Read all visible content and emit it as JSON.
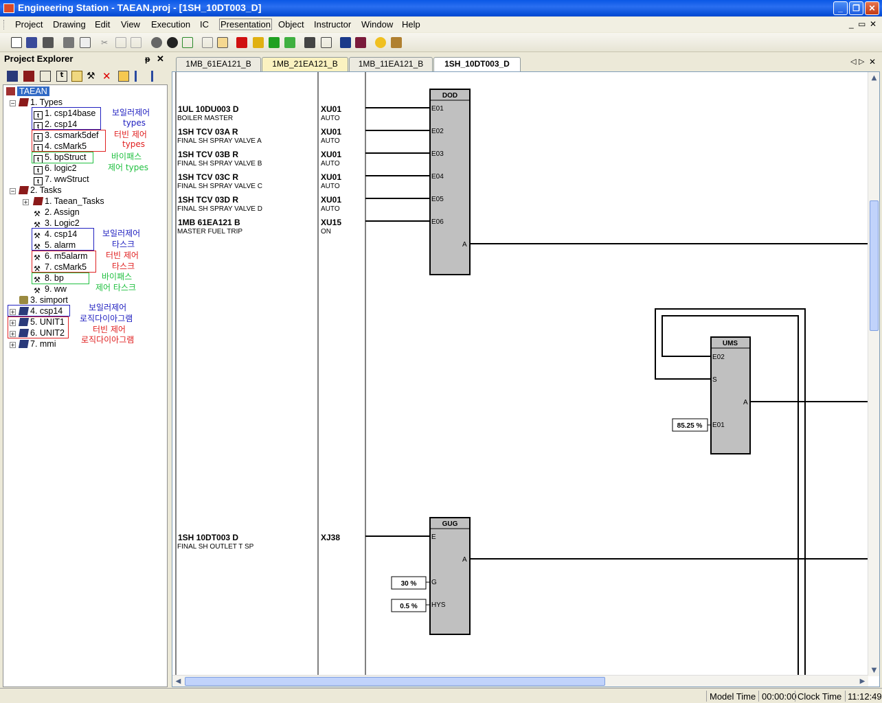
{
  "window": {
    "title": "Engineering Station - TAEAN.proj - [1SH_10DT003_D]",
    "min_icon": "minimize-icon",
    "max_icon": "restore-icon",
    "close_icon": "close-icon"
  },
  "menu": [
    "Project",
    "Drawing",
    "Edit",
    "View",
    "Execution",
    "IC",
    "Presentation",
    "Object",
    "Instructor",
    "Window",
    "Help"
  ],
  "explorer": {
    "title": "Project Explorer",
    "root": "TAEAN",
    "nodes": [
      "1. Types",
      "1. csp14base",
      "2. csp14",
      "3. csmark5def",
      "4. csMark5",
      "5. bpStruct",
      "6. logic2",
      "7. wwStruct",
      "2. Tasks",
      "1. Taean_Tasks",
      "2. Assign",
      "3. Logic2",
      "4. csp14",
      "5. alarm",
      "6. m5alarm",
      "7. csMark5",
      "8. bp",
      "9. ww",
      "3. simport",
      "4. csp14",
      "5. UNIT1",
      "6. UNIT2",
      "7. mmi"
    ],
    "annotations": {
      "boiler_types_1": "보일러제어",
      "boiler_types_2": "types",
      "turbine_types_1": "터빈 제어",
      "turbine_types_2": "types",
      "bypass_types_1": "바이패스",
      "bypass_types_2": "제어 types",
      "boiler_task_1": "보일러제어",
      "boiler_task_2": "타스크",
      "turbine_task_1": "터빈 제어",
      "turbine_task_2": "타스크",
      "bypass_task_1": "바이패스",
      "bypass_task_2": "제어 타스크",
      "boiler_logic_1": "보일러제어",
      "boiler_logic_2": "로직다이아그램",
      "turbine_logic_1": "터빈 제어",
      "turbine_logic_2": "로직다이아그램"
    },
    "colors": {
      "blue": "#2020c0",
      "red": "#e02020",
      "green": "#20c040"
    }
  },
  "tabs": [
    {
      "label": "1MB_61EA121_B",
      "active": false
    },
    {
      "label": "1MB_21EA121_B",
      "active": false
    },
    {
      "label": "1MB_11EA121_B",
      "active": false
    },
    {
      "label": "1SH_10DT003_D",
      "active": true
    }
  ],
  "signals": [
    {
      "tag": "1UL 10DU003 D",
      "desc": "BOILER MASTER",
      "code": "XU01",
      "state": "AUTO"
    },
    {
      "tag": "1SH TCV 03A R",
      "desc": "FINAL SH SPRAY VALVE A",
      "code": "XU01",
      "state": "AUTO"
    },
    {
      "tag": "1SH TCV 03B R",
      "desc": "FINAL SH SPRAY VALVE B",
      "code": "XU01",
      "state": "AUTO"
    },
    {
      "tag": "1SH TCV 03C R",
      "desc": "FINAL SH SPRAY VALVE C",
      "code": "XU01",
      "state": "AUTO"
    },
    {
      "tag": "1SH TCV 03D R",
      "desc": "FINAL SH SPRAY VALVE D",
      "code": "XU01",
      "state": "AUTO"
    },
    {
      "tag": "1MB 61EA121 B",
      "desc": "MASTER FUEL TRIP",
      "code": "XU15",
      "state": "ON"
    },
    {
      "tag": "1SH 10DT003 D",
      "desc": "FINAL SH OUTLET T SP",
      "code": "XJ38",
      "state": ""
    }
  ],
  "blocks": {
    "dod": {
      "name": "DOD",
      "inputs": [
        "E01",
        "E02",
        "E03",
        "E04",
        "E05",
        "E06"
      ],
      "output": "A"
    },
    "ums": {
      "name": "UMS",
      "inputs": [
        "E02",
        "S",
        "E01"
      ],
      "output": "A",
      "e01_value": "85.25 %"
    },
    "gug": {
      "name": "GUG",
      "inputs": [
        "E",
        "G",
        "HYS"
      ],
      "output": "A",
      "g_value": "30 %",
      "hys_value": "0.5 %"
    }
  },
  "status": {
    "model_time_label": "Model Time",
    "model_time": "00:00:00",
    "clock_time_label": "Clock Time",
    "clock_time": "11:12:49"
  }
}
